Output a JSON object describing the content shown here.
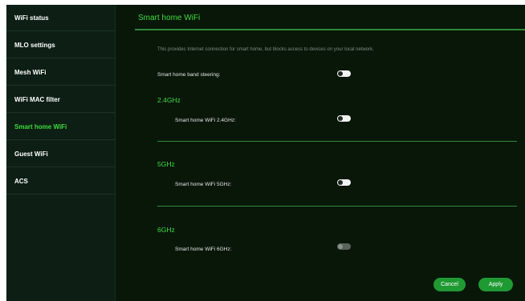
{
  "sidebar": {
    "items": [
      {
        "label": "WiFi status",
        "active": false
      },
      {
        "label": "MLO settings",
        "active": false
      },
      {
        "label": "Mesh WiFi",
        "active": false
      },
      {
        "label": "WiFi MAC filter",
        "active": false
      },
      {
        "label": "Smart home WiFi",
        "active": true
      },
      {
        "label": "Guest WiFi",
        "active": false
      },
      {
        "label": "ACS",
        "active": false
      }
    ]
  },
  "main": {
    "title": "Smart home WiFi",
    "description": "This provides Internet connection for smart home, but blocks access to devices on your local network.",
    "band_steering": {
      "label": "Smart home band steering:",
      "enabled": false
    },
    "bands": [
      {
        "heading": "2.4GHz",
        "label": "Smart home WiFi 2.4GHz:",
        "enabled": false,
        "disabled": false
      },
      {
        "heading": "5GHz",
        "label": "Smart home WiFi 5GHz:",
        "enabled": false,
        "disabled": false
      },
      {
        "heading": "6GHz",
        "label": "Smart home WiFi 6GHz:",
        "enabled": false,
        "disabled": true
      }
    ]
  },
  "actions": {
    "cancel_label": "Cancel",
    "apply_label": "Apply"
  },
  "colors": {
    "accent": "#3ddc3d",
    "button": "#1f9a32",
    "background": "#0a1a10"
  }
}
